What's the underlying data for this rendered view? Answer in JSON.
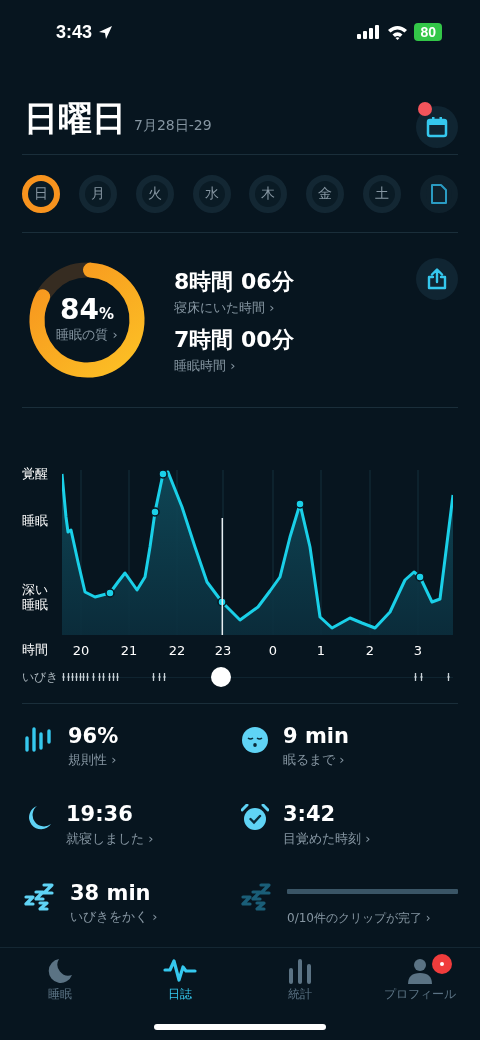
{
  "status_bar": {
    "time": "3:43",
    "battery": "80"
  },
  "header": {
    "title": "日曜日",
    "date_range": "7月28日-29",
    "calendar_badge": true
  },
  "days": [
    {
      "label": "日",
      "kind": "day",
      "selected": true
    },
    {
      "label": "月",
      "kind": "day",
      "selected": false
    },
    {
      "label": "火",
      "kind": "day",
      "selected": false
    },
    {
      "label": "水",
      "kind": "day",
      "selected": false
    },
    {
      "label": "木",
      "kind": "day",
      "selected": false
    },
    {
      "label": "金",
      "kind": "day",
      "selected": false
    },
    {
      "label": "土",
      "kind": "day",
      "selected": false
    },
    {
      "kind": "report",
      "selected": false
    }
  ],
  "summary": {
    "score": "84",
    "score_unit": "%",
    "score_label": "睡眠の質 ›",
    "metrics": [
      {
        "value": "8時間 06分",
        "label": "寝床にいた時間 ›"
      },
      {
        "value": "7時間 00分",
        "label": "睡眠時間 ›"
      }
    ]
  },
  "graph": {
    "y_labels": [
      "覚醒",
      "睡眠",
      "深い睡眠"
    ],
    "x_title": "時間",
    "x_labels": [
      "20",
      "21",
      "22",
      "23",
      "0",
      "1",
      "2",
      "3"
    ],
    "snore_label": "いびき",
    "playhead": {
      "level": 0.41
    }
  },
  "stats": [
    {
      "kind": "regularity",
      "value": "96%",
      "label": "規則性 ›"
    },
    {
      "kind": "fall-asleep",
      "value": "9 min",
      "label": "眠るまで ›"
    },
    {
      "kind": "bedtime",
      "value": "19:36",
      "label": "就寝しました ›"
    },
    {
      "kind": "wake",
      "value": "3:42",
      "label": "目覚めた時刻 ›"
    },
    {
      "kind": "snore",
      "value": "38 min",
      "label": "いびきをかく ›"
    },
    {
      "kind": "clips",
      "level": 0,
      "label": "0/10件のクリップが完了 ›"
    }
  ],
  "tabs": [
    {
      "kind": "sleep",
      "label": "睡眠",
      "selected": false,
      "badge": false
    },
    {
      "kind": "journal",
      "label": "日誌",
      "selected": true,
      "badge": false
    },
    {
      "kind": "stats",
      "label": "統計",
      "selected": false,
      "badge": false
    },
    {
      "kind": "profile",
      "label": "プロフィール",
      "selected": false,
      "badge": true
    }
  ]
}
